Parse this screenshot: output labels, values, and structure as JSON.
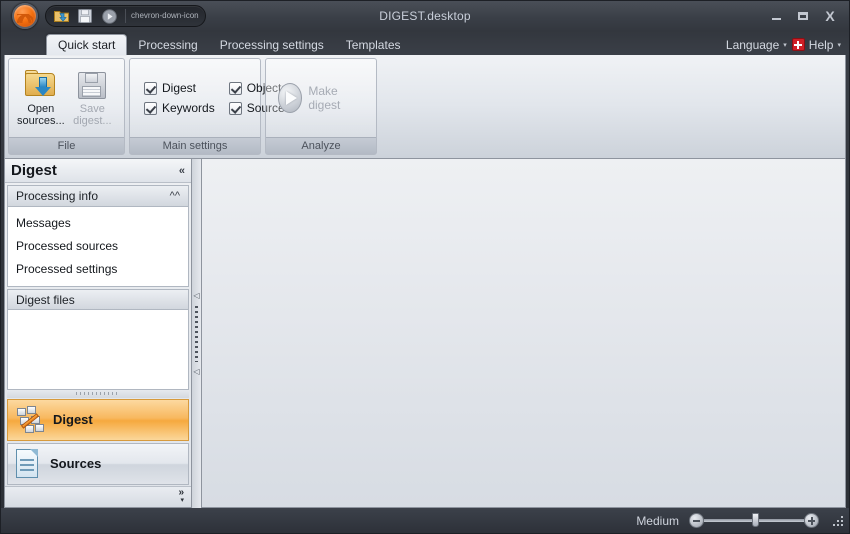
{
  "window": {
    "title": "DIGEST.desktop",
    "logo_icon": "app-logo-icon",
    "controls": {
      "minimize": "minimize-icon",
      "maximize": "maximize-icon",
      "close": "X"
    }
  },
  "quick_access": {
    "items": [
      {
        "icon": "open-folder-icon",
        "name": "open"
      },
      {
        "icon": "save-floppy-icon",
        "name": "save"
      },
      {
        "icon": "play-icon",
        "name": "run"
      }
    ],
    "overflow_icon": "chevron-down-icon"
  },
  "tabs": [
    {
      "label": "Quick start",
      "active": true
    },
    {
      "label": "Processing",
      "active": false
    },
    {
      "label": "Processing settings",
      "active": false
    },
    {
      "label": "Templates",
      "active": false
    }
  ],
  "tabbar_right": {
    "language_label": "Language",
    "language_caret": "▾",
    "help_label": "Help",
    "help_caret": "▾",
    "help_icon": "red-cross-help-icon"
  },
  "ribbon": {
    "groups": [
      {
        "title": "File",
        "buttons": [
          {
            "label": "Open sources...",
            "icon": "open-folder-icon",
            "disabled": false
          },
          {
            "label": "Save digest...",
            "icon": "save-floppy-icon",
            "disabled": true
          }
        ]
      },
      {
        "title": "Main settings",
        "checkboxes": [
          {
            "label": "Digest",
            "checked": true
          },
          {
            "label": "Objects",
            "checked": true
          },
          {
            "label": "Keywords",
            "checked": true
          },
          {
            "label": "Source",
            "checked": true
          }
        ]
      },
      {
        "title": "Analyze",
        "action": {
          "label": "Make digest",
          "icon": "play-icon",
          "disabled": true
        }
      }
    ]
  },
  "sidebar": {
    "title": "Digest",
    "collapse_icon": "«",
    "section": {
      "label": "Processing info",
      "collapse_icon": "«"
    },
    "items": [
      {
        "label": "Messages"
      },
      {
        "label": "Processed sources"
      },
      {
        "label": "Processed settings"
      }
    ],
    "files_section": {
      "label": "Digest files",
      "entries": []
    },
    "nav": [
      {
        "label": "Digest",
        "icon": "blocks-icon",
        "active": true
      },
      {
        "label": "Sources",
        "icon": "document-icon",
        "active": false
      }
    ],
    "footer": {
      "expand_icon": "»",
      "dropdown_icon": "▾"
    }
  },
  "splitter": {
    "collapse_top_icon": "◁",
    "collapse_bottom_icon": "◁"
  },
  "statusbar": {
    "zoom_label": "Medium",
    "zoom_out_icon": "minus-icon",
    "zoom_in_icon": "plus-icon",
    "zoom_value": 50,
    "resize_grip_icon": "resize-grip-icon"
  },
  "colors": {
    "accent_orange": "#f6a93e",
    "titlebar_dark": "#3a3f47",
    "help_red": "#cf2027",
    "folder_yellow": "#e0ad4e",
    "doc_blue": "#5f8fad"
  }
}
